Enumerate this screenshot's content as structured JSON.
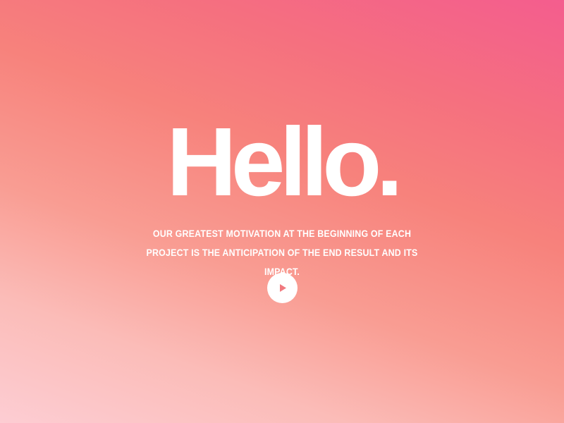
{
  "hero": {
    "title": "Hello.",
    "tagline": "Our greatest motivation at the beginning of each project is the anticipation of the end result and its impact.",
    "play_icon": "play-icon"
  },
  "colors": {
    "gradient_top_right": "#f45d8e",
    "gradient_middle": "#f7827c",
    "gradient_bottom_left": "#fdcdd3",
    "text": "#ffffff",
    "play_button_bg": "#ffffff",
    "play_icon": "#f17a7f"
  }
}
